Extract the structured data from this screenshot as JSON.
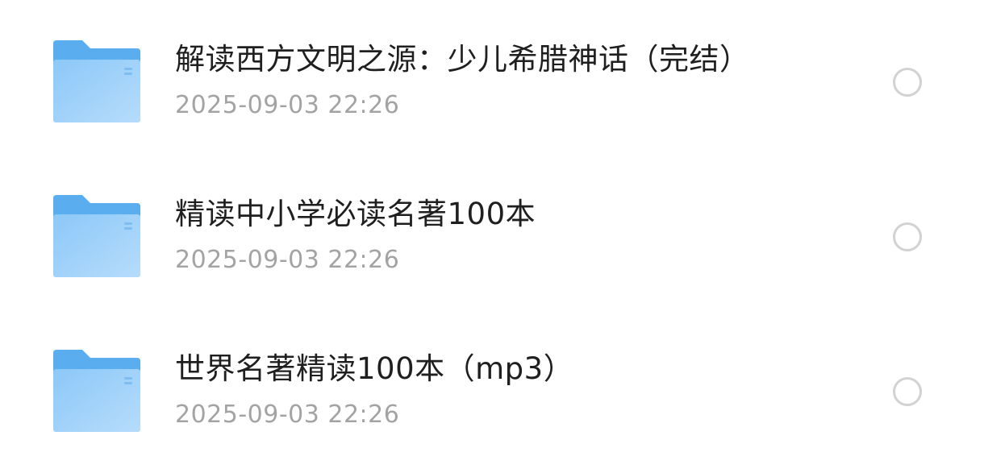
{
  "files": [
    {
      "name": "解读西方文明之源：少儿希腊神话（完结）",
      "date": "2025-09-03 22:26",
      "icon": "folder-icon",
      "selected": false
    },
    {
      "name": "精读中小学必读名著100本",
      "date": "2025-09-03 22:26",
      "icon": "folder-icon",
      "selected": false
    },
    {
      "name": "世界名著精读100本（mp3）",
      "date": "2025-09-03 22:26",
      "icon": "folder-icon",
      "selected": false
    }
  ],
  "colors": {
    "folder_back": "#5AAEF0",
    "folder_front_top": "#8CC8F8",
    "folder_front_bottom": "#B6DCFB",
    "title_text": "#1F1F1F",
    "date_text": "#A3A3A3",
    "radio_border": "#D2D2D2"
  }
}
